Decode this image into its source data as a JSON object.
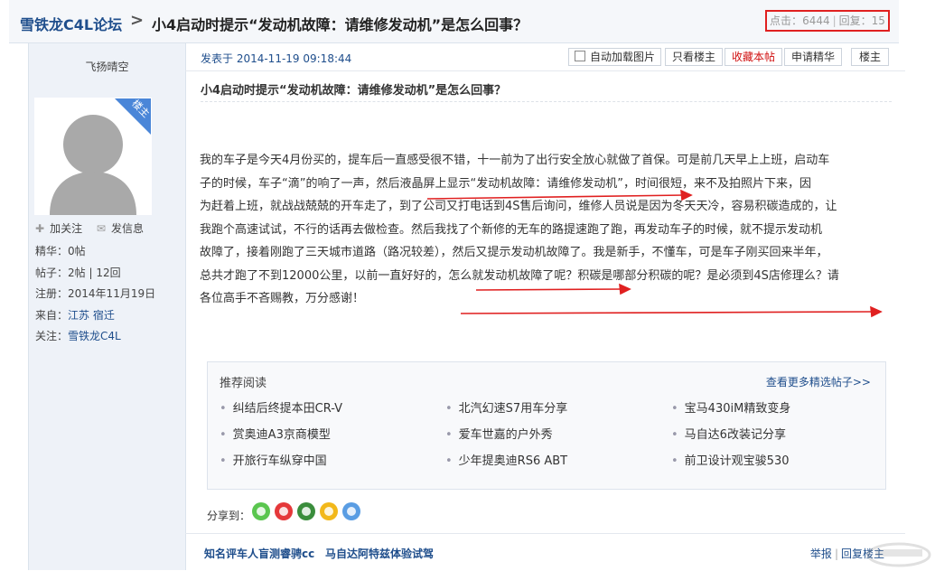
{
  "header": {
    "forum_name": "雪铁龙C4L论坛",
    "separator": ">",
    "thread_title": "小4启动时提示“发动机故障：请维修发动机”是怎么回事？",
    "views_label": "点击：",
    "views": "6444",
    "replies_label": "回复：",
    "replies": "15"
  },
  "author": {
    "name": "飞扬晴空",
    "badge": "楼主",
    "follow_label": "加关注",
    "message_label": "发信息",
    "stats": [
      {
        "label": "精华：",
        "value": "0帖"
      },
      {
        "label": "帖子：",
        "value": "2帖 | 12回"
      },
      {
        "label": "注册：",
        "value": "2014年11月19日"
      },
      {
        "label": "来自：",
        "value": "江苏 宿迁"
      },
      {
        "label": "关注：",
        "value": "雪铁龙C4L"
      }
    ]
  },
  "post": {
    "time": "发表于 2014-11-19 09:18:44",
    "buttons": {
      "autoload": "自动加载图片",
      "only_op": "只看楼主",
      "favorite": "收藏本帖",
      "apply_featured": "申请精华",
      "floor": "楼主"
    },
    "subtitle": "小4启动时提示“发动机故障：请维修发动机”是怎么回事？",
    "lines": [
      "我的车子是今天4月份买的，提车后一直感受很不错，十一前为了出行安全放心就做了首保。可是前几天早上上班，启动车",
      "子的时候，车子“滴”的响了一声，然后液晶屏上显示“发动机故障：请维修发动机”，时间很短，来不及拍照片下来，因",
      "为赶着上班，就战战兢兢的开车走了，到了公司又打电话到4S售后询问，维修人员说是因为冬天天冷，容易积碳造成的，让",
      "我跑个高速试试，不行的话再去做检查。然后我找了个新修的无车的路提速跑了跑，再发动车子的时候，就不提示发动机",
      "故障了，接着刚跑了三天城市道路（路况较差），然后又提示发动机故障了。我是新手，不懂车，可是车子刚买回来半年，",
      "总共才跑了不到12000公里，以前一直好好的，怎么就发动机故障了呢？积碳是哪部分积碳的呢？是必须到4S店修理么？请",
      "各位高手不吝赐教，万分感谢！"
    ],
    "annotation_color": "#e02020"
  },
  "recommend": {
    "title": "推荐阅读",
    "more": "查看更多精选帖子>>",
    "items": [
      "纠结后终提本田CR-V",
      "北汽幻速S7用车分享",
      "宝马430iM精致变身",
      "赏奥迪A3京商模型",
      "爱车世嘉的户外秀",
      "马自达6改装记分享",
      "开旅行车纵穿中国",
      "少年提奥迪RS6 ABT",
      "前卫设计观宝骏530"
    ]
  },
  "share": {
    "label": "分享到：",
    "icons": [
      "wechat-icon",
      "weibo-icon",
      "friends-circle-icon",
      "qzone-icon",
      "qq-icon"
    ]
  },
  "footer": {
    "link1": "知名评车人盲测睿骋cc",
    "link2": "马自达阿特兹体验试驾",
    "report": "举报",
    "reply_op": "回复楼主"
  }
}
